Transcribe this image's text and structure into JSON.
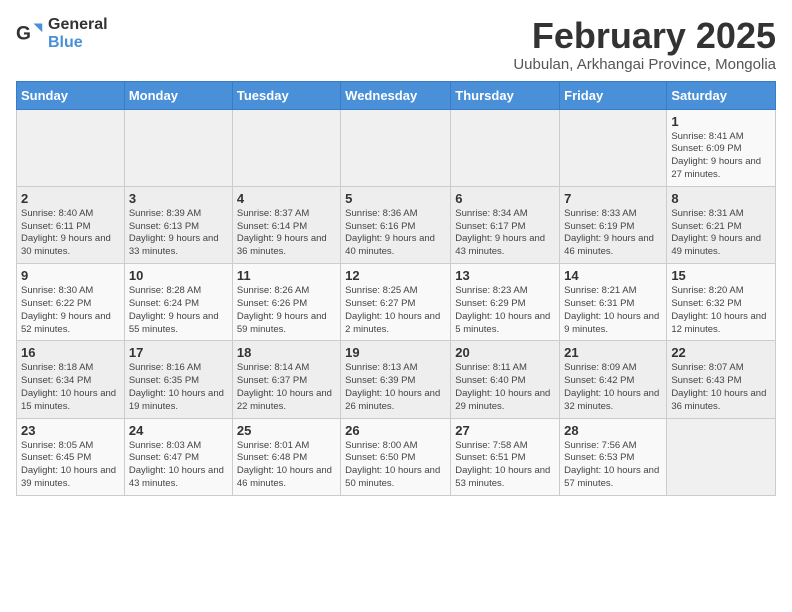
{
  "header": {
    "logo_general": "General",
    "logo_blue": "Blue",
    "title": "February 2025",
    "subtitle": "Uubulan, Arkhangai Province, Mongolia"
  },
  "weekdays": [
    "Sunday",
    "Monday",
    "Tuesday",
    "Wednesday",
    "Thursday",
    "Friday",
    "Saturday"
  ],
  "weeks": [
    [
      {
        "day": "",
        "info": ""
      },
      {
        "day": "",
        "info": ""
      },
      {
        "day": "",
        "info": ""
      },
      {
        "day": "",
        "info": ""
      },
      {
        "day": "",
        "info": ""
      },
      {
        "day": "",
        "info": ""
      },
      {
        "day": "1",
        "info": "Sunrise: 8:41 AM\nSunset: 6:09 PM\nDaylight: 9 hours and 27 minutes."
      }
    ],
    [
      {
        "day": "2",
        "info": "Sunrise: 8:40 AM\nSunset: 6:11 PM\nDaylight: 9 hours and 30 minutes."
      },
      {
        "day": "3",
        "info": "Sunrise: 8:39 AM\nSunset: 6:13 PM\nDaylight: 9 hours and 33 minutes."
      },
      {
        "day": "4",
        "info": "Sunrise: 8:37 AM\nSunset: 6:14 PM\nDaylight: 9 hours and 36 minutes."
      },
      {
        "day": "5",
        "info": "Sunrise: 8:36 AM\nSunset: 6:16 PM\nDaylight: 9 hours and 40 minutes."
      },
      {
        "day": "6",
        "info": "Sunrise: 8:34 AM\nSunset: 6:17 PM\nDaylight: 9 hours and 43 minutes."
      },
      {
        "day": "7",
        "info": "Sunrise: 8:33 AM\nSunset: 6:19 PM\nDaylight: 9 hours and 46 minutes."
      },
      {
        "day": "8",
        "info": "Sunrise: 8:31 AM\nSunset: 6:21 PM\nDaylight: 9 hours and 49 minutes."
      }
    ],
    [
      {
        "day": "9",
        "info": "Sunrise: 8:30 AM\nSunset: 6:22 PM\nDaylight: 9 hours and 52 minutes."
      },
      {
        "day": "10",
        "info": "Sunrise: 8:28 AM\nSunset: 6:24 PM\nDaylight: 9 hours and 55 minutes."
      },
      {
        "day": "11",
        "info": "Sunrise: 8:26 AM\nSunset: 6:26 PM\nDaylight: 9 hours and 59 minutes."
      },
      {
        "day": "12",
        "info": "Sunrise: 8:25 AM\nSunset: 6:27 PM\nDaylight: 10 hours and 2 minutes."
      },
      {
        "day": "13",
        "info": "Sunrise: 8:23 AM\nSunset: 6:29 PM\nDaylight: 10 hours and 5 minutes."
      },
      {
        "day": "14",
        "info": "Sunrise: 8:21 AM\nSunset: 6:31 PM\nDaylight: 10 hours and 9 minutes."
      },
      {
        "day": "15",
        "info": "Sunrise: 8:20 AM\nSunset: 6:32 PM\nDaylight: 10 hours and 12 minutes."
      }
    ],
    [
      {
        "day": "16",
        "info": "Sunrise: 8:18 AM\nSunset: 6:34 PM\nDaylight: 10 hours and 15 minutes."
      },
      {
        "day": "17",
        "info": "Sunrise: 8:16 AM\nSunset: 6:35 PM\nDaylight: 10 hours and 19 minutes."
      },
      {
        "day": "18",
        "info": "Sunrise: 8:14 AM\nSunset: 6:37 PM\nDaylight: 10 hours and 22 minutes."
      },
      {
        "day": "19",
        "info": "Sunrise: 8:13 AM\nSunset: 6:39 PM\nDaylight: 10 hours and 26 minutes."
      },
      {
        "day": "20",
        "info": "Sunrise: 8:11 AM\nSunset: 6:40 PM\nDaylight: 10 hours and 29 minutes."
      },
      {
        "day": "21",
        "info": "Sunrise: 8:09 AM\nSunset: 6:42 PM\nDaylight: 10 hours and 32 minutes."
      },
      {
        "day": "22",
        "info": "Sunrise: 8:07 AM\nSunset: 6:43 PM\nDaylight: 10 hours and 36 minutes."
      }
    ],
    [
      {
        "day": "23",
        "info": "Sunrise: 8:05 AM\nSunset: 6:45 PM\nDaylight: 10 hours and 39 minutes."
      },
      {
        "day": "24",
        "info": "Sunrise: 8:03 AM\nSunset: 6:47 PM\nDaylight: 10 hours and 43 minutes."
      },
      {
        "day": "25",
        "info": "Sunrise: 8:01 AM\nSunset: 6:48 PM\nDaylight: 10 hours and 46 minutes."
      },
      {
        "day": "26",
        "info": "Sunrise: 8:00 AM\nSunset: 6:50 PM\nDaylight: 10 hours and 50 minutes."
      },
      {
        "day": "27",
        "info": "Sunrise: 7:58 AM\nSunset: 6:51 PM\nDaylight: 10 hours and 53 minutes."
      },
      {
        "day": "28",
        "info": "Sunrise: 7:56 AM\nSunset: 6:53 PM\nDaylight: 10 hours and 57 minutes."
      },
      {
        "day": "",
        "info": ""
      }
    ]
  ]
}
